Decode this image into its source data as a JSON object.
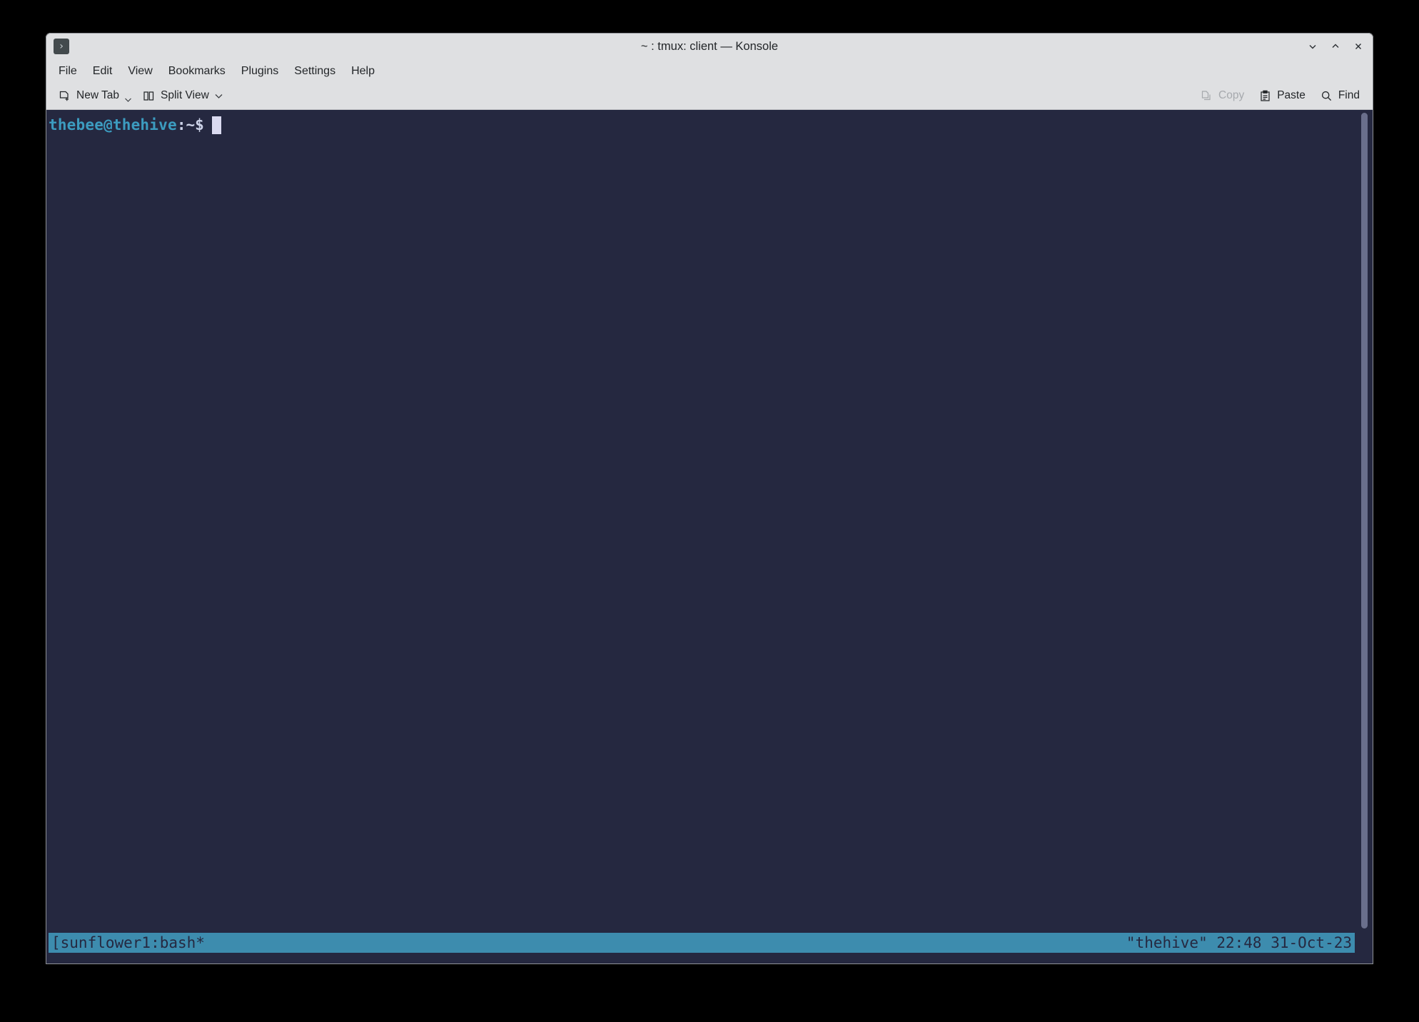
{
  "window": {
    "title": "~ : tmux: client — Konsole",
    "app_icon": "terminal-prompt-icon",
    "controls": [
      {
        "name": "minimize",
        "glyph": "chevron-down"
      },
      {
        "name": "maximize",
        "glyph": "chevron-up"
      },
      {
        "name": "close",
        "glyph": "x"
      }
    ]
  },
  "menubar": {
    "items": [
      {
        "label": "File"
      },
      {
        "label": "Edit"
      },
      {
        "label": "View"
      },
      {
        "label": "Bookmarks"
      },
      {
        "label": "Plugins"
      },
      {
        "label": "Settings"
      },
      {
        "label": "Help"
      }
    ]
  },
  "toolbar": {
    "new_tab_label": "New Tab",
    "split_view_label": "Split View",
    "copy_label": "Copy",
    "copy_enabled": false,
    "paste_label": "Paste",
    "find_label": "Find"
  },
  "terminal": {
    "prompt_user_host": "thebee@thehive",
    "prompt_path": ":~$",
    "cursor": "block",
    "colors": {
      "background": "#252840",
      "prompt_accent": "#3c9cc0",
      "foreground": "#cdd3e8",
      "cursor": "#dadaf0"
    }
  },
  "tmux": {
    "left_status": "[sunflower1:bash*",
    "right_status": "\"thehive\" 22:48 31-Oct-23",
    "session_window": "sunflower1",
    "pane_program": "bash",
    "active_marker": "*",
    "hostname": "\"thehive\"",
    "time": "22:48",
    "date": "31-Oct-23",
    "colors": {
      "status_bg": "#3d8cae",
      "status_fg": "#252840"
    }
  }
}
